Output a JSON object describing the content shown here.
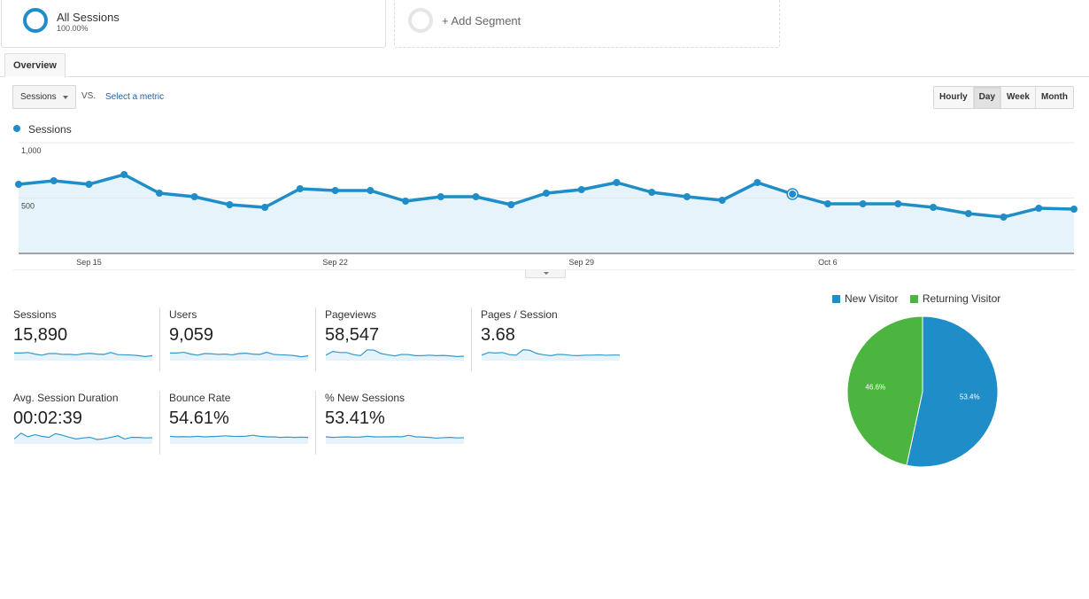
{
  "segments": {
    "active": {
      "name": "All Sessions",
      "percent": "100.00%"
    },
    "add_label": "+ Add Segment"
  },
  "tabs": [
    {
      "label": "Overview",
      "active": true
    }
  ],
  "controls": {
    "metric_select": "Sessions",
    "vs_label": "VS.",
    "select_metric_link": "Select a metric",
    "granularity": [
      {
        "label": "Hourly",
        "active": false
      },
      {
        "label": "Day",
        "active": true
      },
      {
        "label": "Week",
        "active": false
      },
      {
        "label": "Month",
        "active": false
      }
    ]
  },
  "colors": {
    "primary": "#1f8dc8",
    "area": "#e6f3fb",
    "returning": "#4cb53f"
  },
  "chart_data": [
    {
      "type": "line",
      "title": "",
      "legend": [
        "Sessions"
      ],
      "legend_position": "top-left",
      "x": [
        "Sep 13",
        "Sep 14",
        "Sep 15",
        "Sep 16",
        "Sep 17",
        "Sep 18",
        "Sep 19",
        "Sep 20",
        "Sep 21",
        "Sep 22",
        "Sep 23",
        "Sep 24",
        "Sep 25",
        "Sep 26",
        "Sep 27",
        "Sep 28",
        "Sep 29",
        "Sep 30",
        "Oct 1",
        "Oct 2",
        "Oct 3",
        "Oct 4",
        "Oct 5",
        "Oct 6",
        "Oct 7",
        "Oct 8",
        "Oct 9",
        "Oct 10",
        "Oct 11",
        "Oct 12",
        "Oct 13"
      ],
      "series": [
        {
          "name": "Sessions",
          "values": [
            624,
            656,
            624,
            712,
            544,
            512,
            440,
            416,
            584,
            568,
            568,
            472,
            512,
            512,
            440,
            544,
            576,
            640,
            552,
            512,
            480,
            640,
            536,
            448,
            448,
            448,
            416,
            360,
            328,
            408,
            400
          ]
        }
      ],
      "highlighted_index": 22,
      "xticks": [
        "Sep 15",
        "Sep 22",
        "Sep 29",
        "Oct 6"
      ],
      "xtick_indices": [
        2,
        9,
        16,
        23
      ],
      "yticks": [
        "1,000",
        "500"
      ],
      "ytick_values": [
        1000,
        500
      ],
      "ylim": [
        0,
        1000
      ],
      "grid": true,
      "fill": true
    },
    {
      "type": "pie",
      "title": "",
      "legend": [
        "New Visitor",
        "Returning Visitor"
      ],
      "legend_position": "top",
      "labels": [
        "New Visitor",
        "Returning Visitor"
      ],
      "values": [
        53.4,
        46.6
      ],
      "data_labels": [
        "53.4%",
        "46.6%"
      ]
    }
  ],
  "scorecards": [
    {
      "label": "Sessions",
      "value": "15,890",
      "spark": [
        0.55,
        0.55,
        0.6,
        0.45,
        0.35,
        0.5,
        0.5,
        0.42,
        0.43,
        0.38,
        0.48,
        0.52,
        0.45,
        0.42,
        0.6,
        0.4,
        0.38,
        0.36,
        0.3,
        0.22,
        0.3
      ]
    },
    {
      "label": "Users",
      "value": "9,059",
      "spark": [
        0.55,
        0.55,
        0.62,
        0.45,
        0.35,
        0.5,
        0.48,
        0.42,
        0.45,
        0.38,
        0.5,
        0.53,
        0.45,
        0.42,
        0.62,
        0.42,
        0.38,
        0.36,
        0.3,
        0.2,
        0.28
      ]
    },
    {
      "label": "Pageviews",
      "value": "58,547",
      "spark": [
        0.35,
        0.7,
        0.6,
        0.6,
        0.4,
        0.3,
        0.85,
        0.82,
        0.5,
        0.38,
        0.28,
        0.42,
        0.4,
        0.3,
        0.3,
        0.35,
        0.3,
        0.32,
        0.28,
        0.22,
        0.25
      ]
    },
    {
      "label": "Pages / Session",
      "value": "3.68",
      "spark": [
        0.35,
        0.6,
        0.55,
        0.6,
        0.4,
        0.35,
        0.85,
        0.8,
        0.5,
        0.38,
        0.3,
        0.42,
        0.4,
        0.33,
        0.3,
        0.35,
        0.35,
        0.38,
        0.34,
        0.36,
        0.36
      ]
    },
    {
      "label": "Avg. Session Duration",
      "value": "00:02:39",
      "spark": [
        0.3,
        0.85,
        0.5,
        0.7,
        0.55,
        0.45,
        0.8,
        0.65,
        0.45,
        0.3,
        0.4,
        0.45,
        0.25,
        0.32,
        0.45,
        0.6,
        0.3,
        0.45,
        0.45,
        0.4,
        0.42
      ]
    },
    {
      "label": "Bounce Rate",
      "value": "54.61%",
      "spark": [
        0.55,
        0.5,
        0.52,
        0.5,
        0.55,
        0.5,
        0.52,
        0.55,
        0.6,
        0.55,
        0.54,
        0.56,
        0.65,
        0.55,
        0.5,
        0.5,
        0.45,
        0.48,
        0.45,
        0.47,
        0.45
      ]
    },
    {
      "label": "% New Sessions",
      "value": "53.41%",
      "spark": [
        0.5,
        0.45,
        0.48,
        0.5,
        0.47,
        0.48,
        0.55,
        0.5,
        0.5,
        0.5,
        0.52,
        0.5,
        0.65,
        0.5,
        0.48,
        0.45,
        0.38,
        0.42,
        0.45,
        0.4,
        0.42
      ]
    }
  ]
}
